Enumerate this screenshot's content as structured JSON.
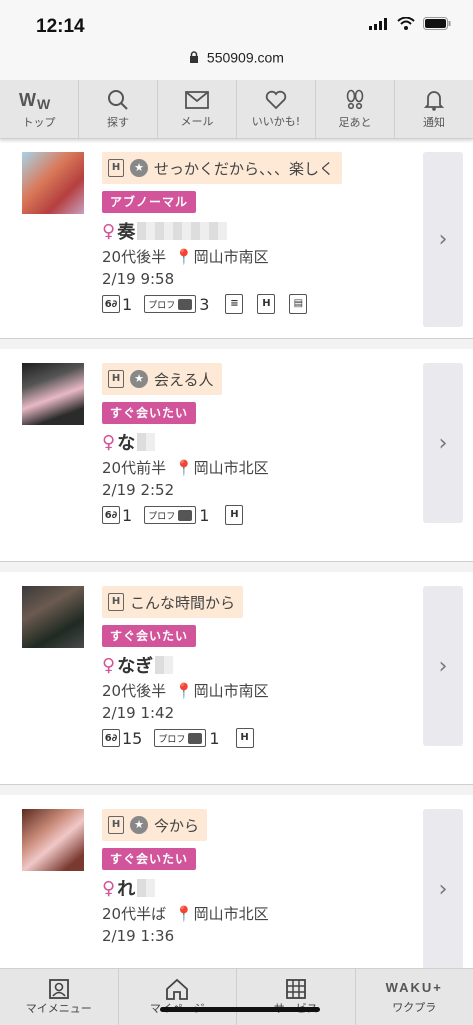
{
  "status": {
    "time": "12:14"
  },
  "url": "550909.com",
  "nav": [
    {
      "label": "トップ",
      "icon": "ww-logo-icon"
    },
    {
      "label": "探す",
      "icon": "search-icon"
    },
    {
      "label": "メール",
      "icon": "mail-icon"
    },
    {
      "label": "いいかも!",
      "icon": "heart-icon"
    },
    {
      "label": "足あと",
      "icon": "footprint-icon"
    },
    {
      "label": "通知",
      "icon": "bell-icon"
    }
  ],
  "profiles": [
    {
      "comment": "せっかくだから、、、楽しく",
      "star": true,
      "tag": "アブノーマル",
      "name": "奏",
      "age": "20代後半",
      "area": "岡山市南区",
      "date": "2/19 9:58",
      "views": "1",
      "photos": "3",
      "extra_icons": 3
    },
    {
      "comment": "会える人",
      "star": true,
      "tag": "すぐ会いたい",
      "name": "な",
      "age": "20代前半",
      "area": "岡山市北区",
      "date": "2/19 2:52",
      "views": "1",
      "photos": "1",
      "extra_icons": 1
    },
    {
      "comment": "こんな時間から",
      "star": false,
      "tag": "すぐ会いたい",
      "name": "なぎ",
      "age": "20代後半",
      "area": "岡山市南区",
      "date": "2/19 1:42",
      "views": "15",
      "photos": "1",
      "extra_icons": 1
    },
    {
      "comment": "今から",
      "star": true,
      "tag": "すぐ会いたい",
      "name": "れ",
      "age": "20代半ば",
      "area": "岡山市北区",
      "date": "2/19 1:36",
      "views": "",
      "photos": "",
      "extra_icons": 1
    }
  ],
  "prof_label": "プロフ",
  "bottom_nav": [
    {
      "label": "マイメニュー",
      "icon": "user-card-icon"
    },
    {
      "label": "マイページ",
      "icon": "home-icon"
    },
    {
      "label": "サービス",
      "icon": "grid-icon"
    },
    {
      "label": "ワクプラ",
      "icon": "wakuplus-logo-icon",
      "logo_text": "WAKU+"
    }
  ],
  "colors": {
    "tag": "#d2549b",
    "comment_bg": "#fde9d6"
  }
}
